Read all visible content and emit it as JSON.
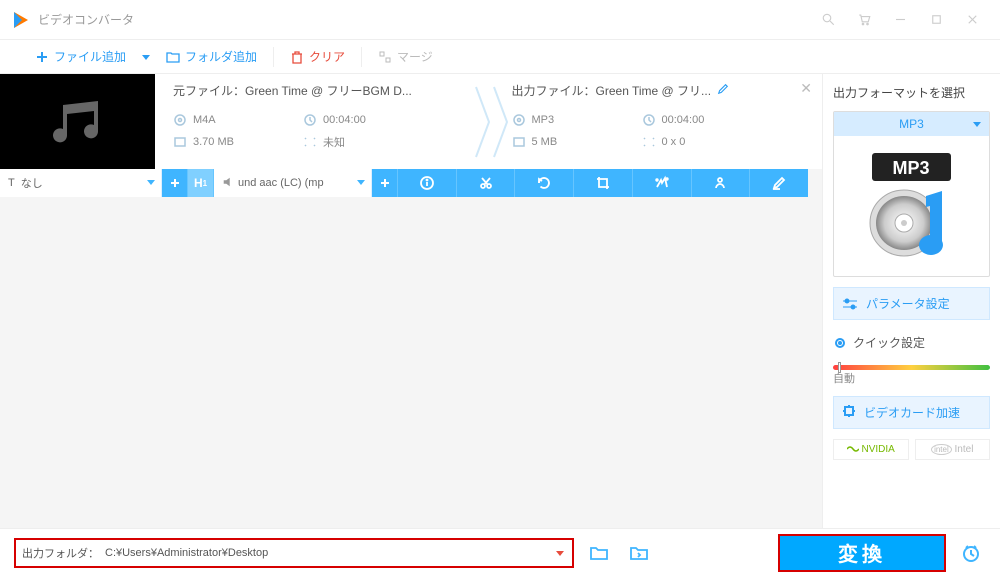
{
  "window": {
    "title": "ビデオコンバータ"
  },
  "toolbar": {
    "add_file": "ファイル追加",
    "add_folder": "フォルダ追加",
    "clear": "クリア",
    "merge": "マージ"
  },
  "file": {
    "src_label": "元ファイル：",
    "src_name": "Green Time @ フリーBGM D...",
    "src_format": "M4A",
    "src_duration": "00:04:00",
    "src_size": "3.70 MB",
    "src_res": "未知",
    "out_label": "出力ファイル：",
    "out_name": "Green Time @ フリ...",
    "out_format": "MP3",
    "out_duration": "00:04:00",
    "out_size": "5 MB",
    "out_res": "0 x 0"
  },
  "strip": {
    "subtitle": "なし",
    "audio": "und aac (LC) (mp"
  },
  "panel": {
    "title": "出力フォーマットを選択",
    "format": "MP3",
    "badge": "MP3",
    "param": "パラメータ設定",
    "quick": "クイック設定",
    "auto": "自動",
    "gpu": "ビデオカード加速",
    "nvidia": "NVIDIA",
    "intel": "Intel"
  },
  "bottom": {
    "out_label": "出力フォルダ：",
    "out_path": "C:¥Users¥Administrator¥Desktop",
    "convert": "変換"
  }
}
